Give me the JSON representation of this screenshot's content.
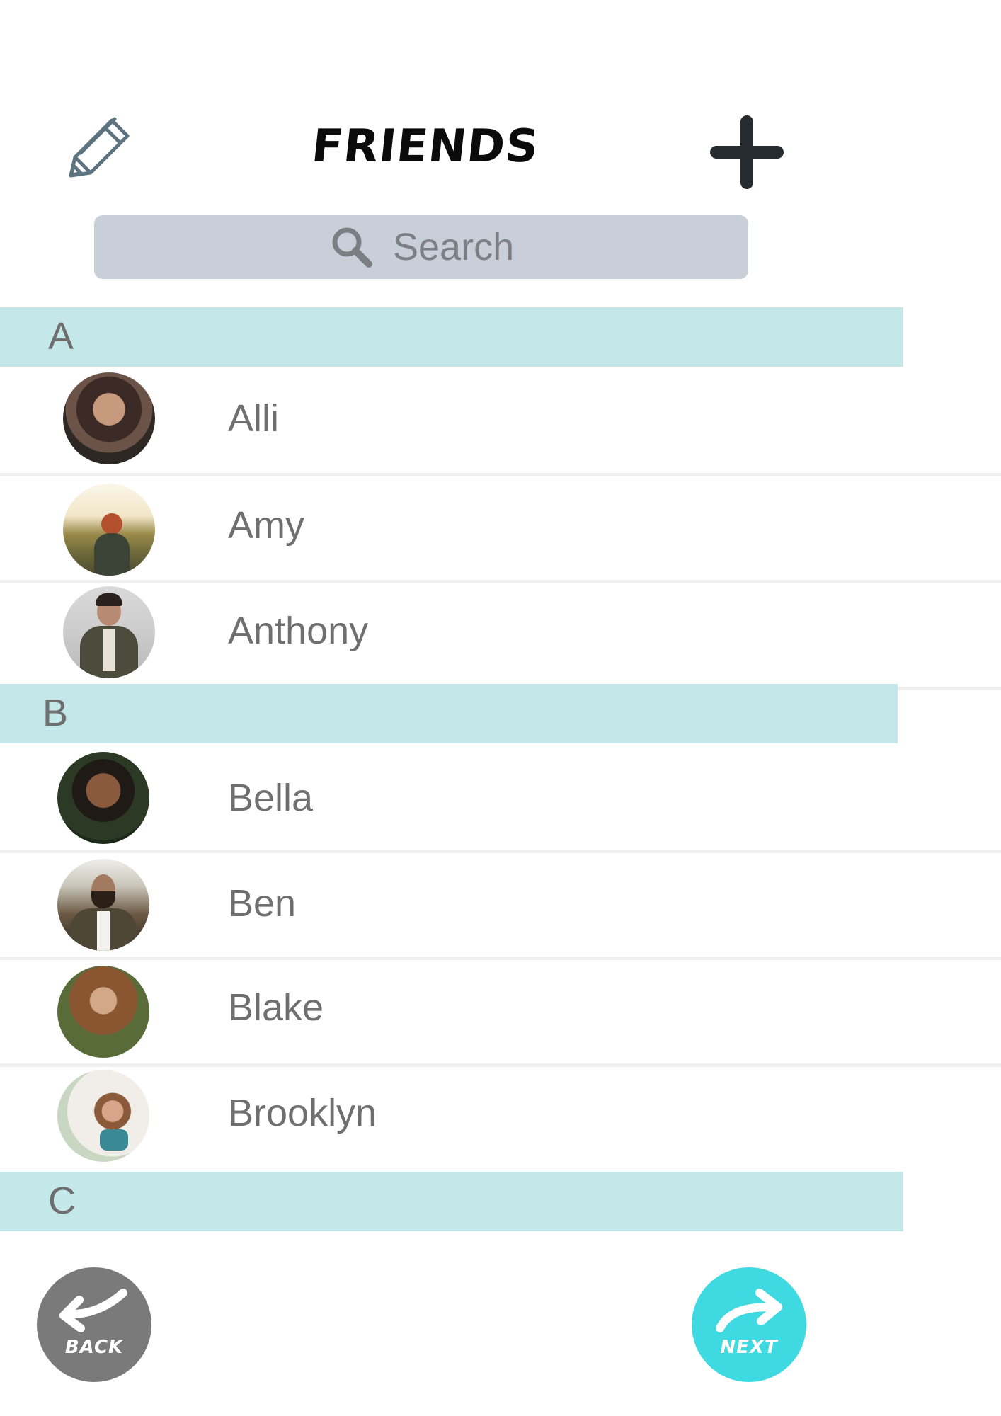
{
  "header": {
    "title": "FRIENDS",
    "edit_icon": "pencil-icon",
    "add_icon": "plus-icon"
  },
  "search": {
    "placeholder": "Search",
    "icon": "search-icon"
  },
  "sections": [
    {
      "letter": "A",
      "contacts": [
        {
          "name": "Alli"
        },
        {
          "name": "Amy"
        },
        {
          "name": "Anthony"
        }
      ]
    },
    {
      "letter": "B",
      "contacts": [
        {
          "name": "Bella"
        },
        {
          "name": "Ben"
        },
        {
          "name": "Blake"
        },
        {
          "name": "Brooklyn"
        }
      ]
    },
    {
      "letter": "C",
      "contacts": []
    }
  ],
  "footer": {
    "back_label": "BACK",
    "next_label": "NEXT"
  },
  "colors": {
    "section_bg": "#c4e7ea",
    "search_bg": "#c8cfd8",
    "next_button": "#3fd9e2",
    "back_button": "#7a7a7a"
  }
}
